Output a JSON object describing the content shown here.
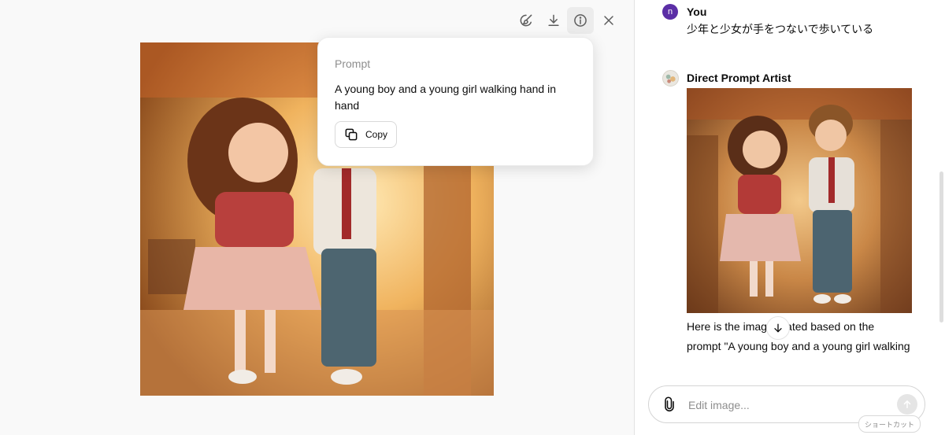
{
  "toolbar": {
    "icons": [
      "edit-brush-icon",
      "download-icon",
      "info-icon",
      "close-icon"
    ],
    "active": "info-icon"
  },
  "prompt_popover": {
    "label": "Prompt",
    "text": "A young boy and a young girl walking hand in hand",
    "copy_label": "Copy"
  },
  "chat": {
    "user": {
      "avatar_letter": "n",
      "avatar_color": "#5b2ea6",
      "name": "You",
      "message": "少年と少女が手をつないで歩いている"
    },
    "assistant": {
      "name": "Direct Prompt Artist",
      "reply_line1": "Here is the imag  nerated based on the",
      "reply_line2": "prompt \"A young boy and a young girl walking"
    }
  },
  "composer": {
    "placeholder": "Edit image...",
    "shortcut_label": "ショートカット"
  }
}
